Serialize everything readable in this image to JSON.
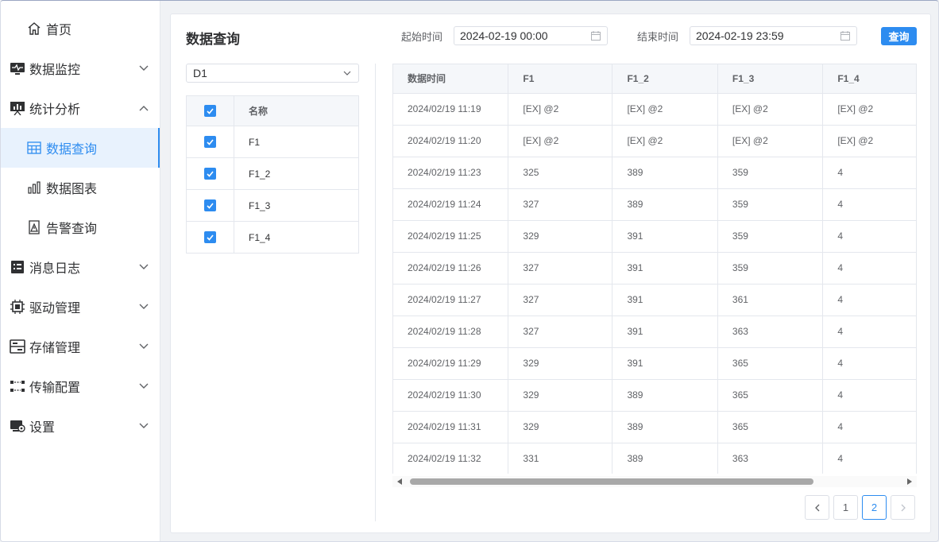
{
  "sidebar": {
    "items": [
      {
        "label": "首页",
        "icon": "home-icon"
      },
      {
        "label": "数据监控",
        "icon": "monitor-icon"
      },
      {
        "label": "统计分析",
        "icon": "chart-board-icon"
      },
      {
        "label": "数据查询",
        "icon": "table-icon"
      },
      {
        "label": "数据图表",
        "icon": "bar-chart-icon"
      },
      {
        "label": "告警查询",
        "icon": "alert-doc-icon"
      },
      {
        "label": "消息日志",
        "icon": "list-icon"
      },
      {
        "label": "驱动管理",
        "icon": "chip-icon"
      },
      {
        "label": "存储管理",
        "icon": "storage-icon"
      },
      {
        "label": "传输配置",
        "icon": "transfer-icon"
      },
      {
        "label": "设置",
        "icon": "settings-icon"
      }
    ]
  },
  "main": {
    "title": "数据查询",
    "start_label": "起始时间",
    "start_value": "2024-02-19 00:00",
    "end_label": "结束时间",
    "end_value": "2024-02-19 23:59",
    "query_button": "查询",
    "device_select": "D1"
  },
  "tag_table": {
    "header": "名称",
    "rows": [
      "F1",
      "F1_2",
      "F1_3",
      "F1_4"
    ]
  },
  "data_table": {
    "columns": [
      "数据时间",
      "F1",
      "F1_2",
      "F1_3",
      "F1_4"
    ],
    "rows": [
      [
        "2024/02/19 11:19",
        "[EX] @2",
        "[EX] @2",
        "[EX] @2",
        "[EX] @2"
      ],
      [
        "2024/02/19 11:20",
        "[EX] @2",
        "[EX] @2",
        "[EX] @2",
        "[EX] @2"
      ],
      [
        "2024/02/19 11:23",
        "325",
        "389",
        "359",
        "4"
      ],
      [
        "2024/02/19 11:24",
        "327",
        "389",
        "359",
        "4"
      ],
      [
        "2024/02/19 11:25",
        "329",
        "391",
        "359",
        "4"
      ],
      [
        "2024/02/19 11:26",
        "327",
        "391",
        "359",
        "4"
      ],
      [
        "2024/02/19 11:27",
        "327",
        "391",
        "361",
        "4"
      ],
      [
        "2024/02/19 11:28",
        "327",
        "391",
        "363",
        "4"
      ],
      [
        "2024/02/19 11:29",
        "329",
        "391",
        "365",
        "4"
      ],
      [
        "2024/02/19 11:30",
        "329",
        "389",
        "365",
        "4"
      ],
      [
        "2024/02/19 11:31",
        "329",
        "389",
        "365",
        "4"
      ],
      [
        "2024/02/19 11:32",
        "331",
        "389",
        "363",
        "4"
      ]
    ]
  },
  "pagination": {
    "pages": [
      "1",
      "2"
    ],
    "current": "2"
  },
  "colors": {
    "accent": "#2d8cf0",
    "active_bg": "#e8f2fd"
  }
}
